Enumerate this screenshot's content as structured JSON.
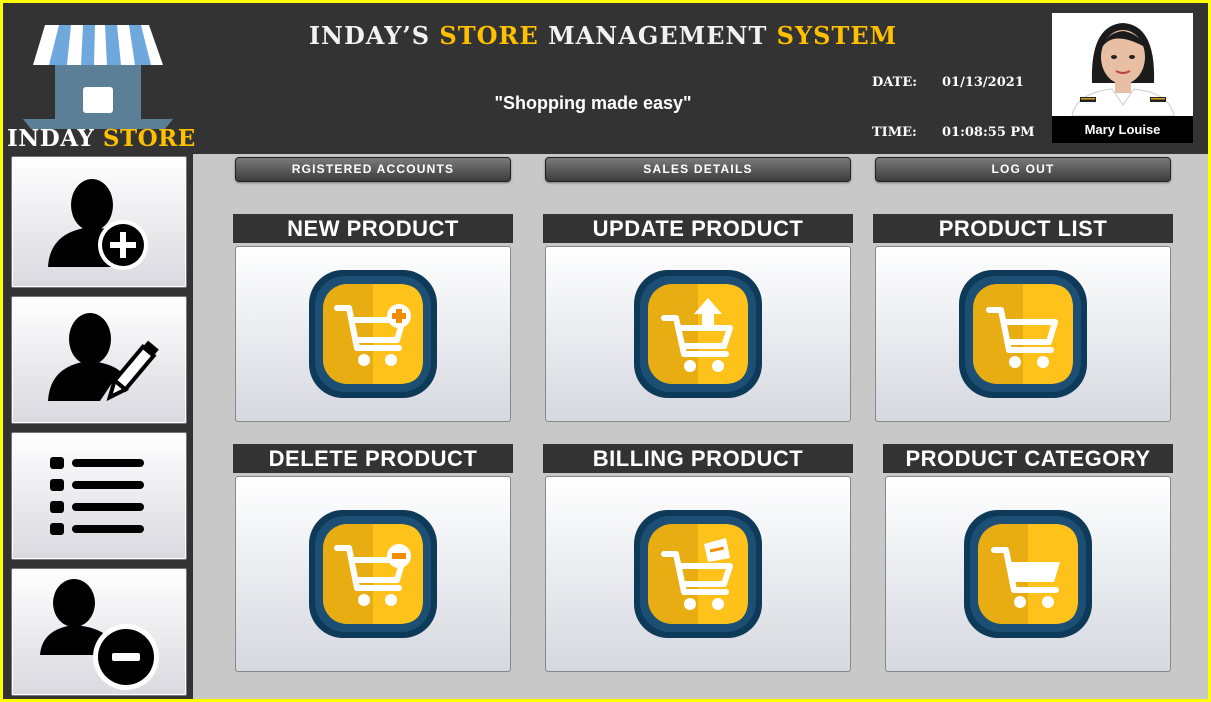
{
  "header": {
    "store_name_part1": "INDAY",
    "store_name_part2": "STORE",
    "title_w1": "INDAY’S",
    "title_y1": "STORE",
    "title_w2": "MANAGEMENT",
    "title_y2": "SYSTEM",
    "tagline": "\"Shopping made easy\"",
    "date_label": "DATE:",
    "date_value": "01/13/2021",
    "time_label": "TIME:",
    "time_value": "01:08:55 PM"
  },
  "profile": {
    "name": "Mary Louise"
  },
  "sidebar": {
    "items": [
      {
        "icon": "add-user-icon"
      },
      {
        "icon": "edit-user-icon"
      },
      {
        "icon": "list-icon"
      },
      {
        "icon": "remove-user-icon"
      }
    ]
  },
  "nav": {
    "registered_accounts": "RGISTERED ACCOUNTS",
    "sales_details": "SALES  DETAILS",
    "log_out": "LOG OUT"
  },
  "tiles": {
    "new_product": "NEW PRODUCT",
    "update_product": "UPDATE PRODUCT",
    "product_list": "PRODUCT LIST",
    "delete_product": "DELETE PRODUCT",
    "billing_product": "BILLING PRODUCT",
    "product_category": "PRODUCT CATEGORY"
  },
  "colors": {
    "frame": "#ffff00",
    "header_bg": "#333333",
    "accent": "#ffc000",
    "workspace": "#c8c8c8",
    "icon_ring": "#0e3a5a"
  }
}
